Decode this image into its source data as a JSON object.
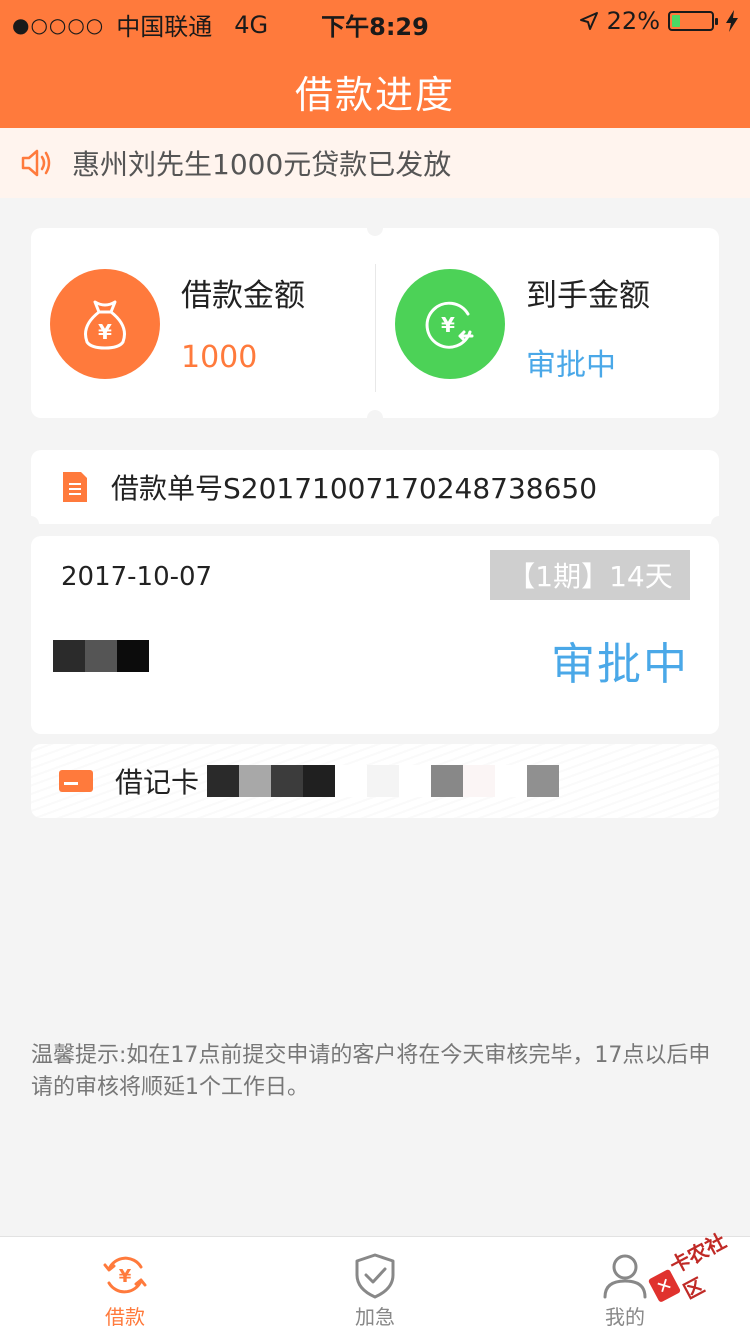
{
  "status_bar": {
    "signal": "●○○○○",
    "carrier": "中国联通",
    "network": "4G",
    "time": "下午8:29",
    "battery_percent": "22%",
    "battery_level": 0.22
  },
  "nav": {
    "title": "借款进度"
  },
  "notice": {
    "text": "惠州刘先生1000元贷款已发放"
  },
  "amount_card": {
    "loan_label": "借款金额",
    "loan_value": "1000",
    "received_label": "到手金额",
    "received_value": "审批中"
  },
  "order": {
    "label": "借款单号S20171007170248738650"
  },
  "detail": {
    "date": "2017-10-07",
    "term": "【1期】14天",
    "status": "审批中"
  },
  "bank_card": {
    "label": "借记卡"
  },
  "tip": {
    "text": "温馨提示:如在17点前提交申请的客户将在今天审核完毕，17点以后申请的审核将顺延1个工作日。"
  },
  "tabs": [
    {
      "label": "借款",
      "icon": "loan-cycle-icon",
      "active": true
    },
    {
      "label": "加急",
      "icon": "shield-check-icon",
      "active": false
    },
    {
      "label": "我的",
      "icon": "person-icon",
      "active": false
    }
  ],
  "watermark": {
    "text": "卡农社区"
  },
  "colors": {
    "brand": "#ff7a3c",
    "green": "#4cd257",
    "status_blue": "#4aa8e8"
  }
}
